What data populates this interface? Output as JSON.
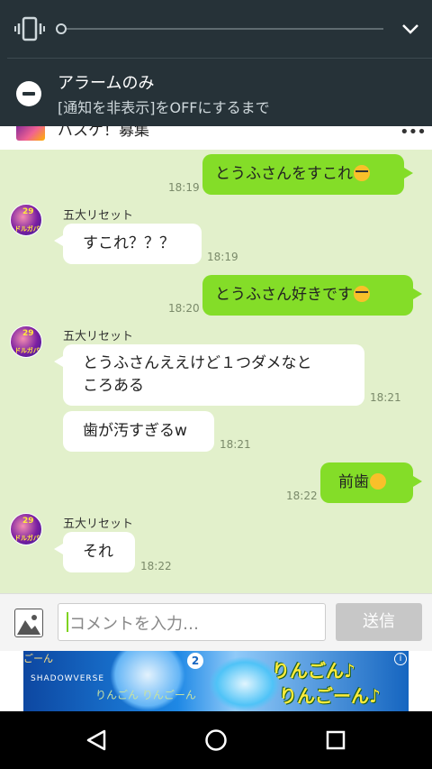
{
  "notification": {
    "title": "アラームのみ",
    "subtitle": "[通知を非表示]をOFFにするまで",
    "volume_level": 0
  },
  "header": {
    "name": "バスケ！募集",
    "more": "•••"
  },
  "messages": [
    {
      "side": "me",
      "text": "とうふさんをすこれ",
      "emoji": "nerd-face-emoji",
      "time": "18:19"
    },
    {
      "side": "them",
      "sender": "五大リセット",
      "text": "すこれ？？？",
      "time": "18:19"
    },
    {
      "side": "me",
      "text": "とうふさん好きです",
      "emoji": "glasses-face-emoji",
      "time": "18:20"
    },
    {
      "side": "them",
      "sender": "五大リセット",
      "text_line1": "とうふさんええけど１つダメなと",
      "text_line2": "ころある",
      "time": "18:21"
    },
    {
      "side": "them",
      "text": "歯が汚すぎるw",
      "time": "18:21"
    },
    {
      "side": "me",
      "text": "前歯",
      "emoji": "rofl-emoji",
      "time": "18:22"
    },
    {
      "side": "them",
      "sender": "五大リセット",
      "text": "それ",
      "time": "18:22"
    }
  ],
  "avatar": {
    "number": "29",
    "caption": "ドルガバ"
  },
  "input": {
    "placeholder": "コメントを入力…",
    "send_label": "送信"
  },
  "ad": {
    "brand": "SHADOWVERSE",
    "headline1": "りんごん♪",
    "headline2": "りんごーん♪",
    "corner": "ごーん",
    "small": "りんごん りんごーん",
    "badge": "2",
    "info": "i"
  },
  "colors": {
    "shade_bg": "#263238",
    "chat_bg": "#e2f0cb",
    "my_bubble": "#84dd28",
    "their_bubble": "#ffffff",
    "send_button": "#c7c7c7"
  }
}
